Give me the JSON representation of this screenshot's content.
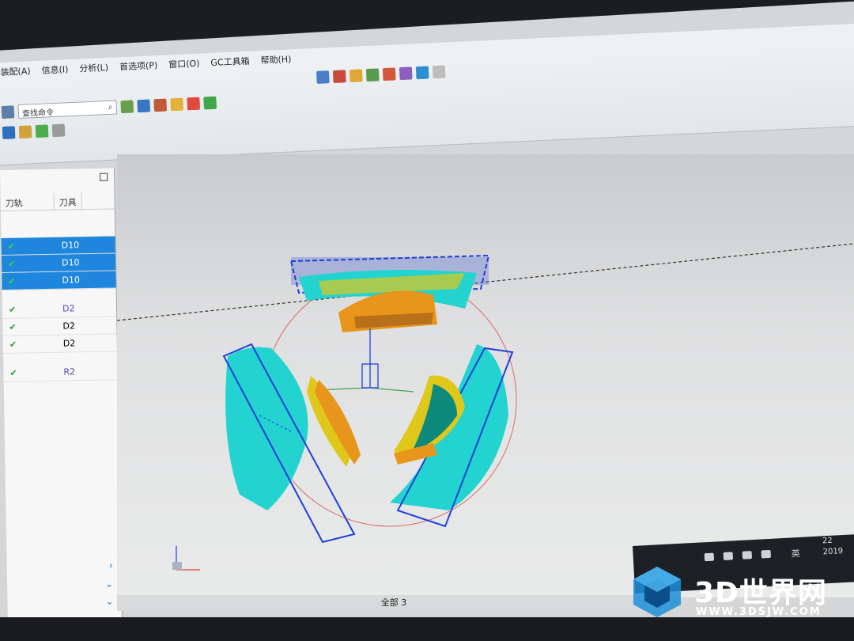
{
  "menu": {
    "items": [
      "装配(A)",
      "信息(I)",
      "分析(L)",
      "首选项(P)",
      "窗口(O)",
      "GC工具箱",
      "帮助(H)"
    ]
  },
  "toolbar": {
    "search_placeholder": "查找命令"
  },
  "navigator": {
    "columns": [
      "刀轨",
      "刀具"
    ],
    "rows": [
      {
        "tool": "D10",
        "selected": true
      },
      {
        "tool": "D10",
        "selected": true
      },
      {
        "tool": "D10",
        "selected": true
      },
      {
        "tool": "D2",
        "selected": false
      },
      {
        "tool": "D2",
        "selected": false
      },
      {
        "tool": "D2",
        "selected": false
      },
      {
        "tool": "R2",
        "selected": false
      }
    ]
  },
  "status_bar": {
    "text": "全部 3"
  },
  "taskbar": {
    "ime": "英",
    "clock_line1": "22",
    "clock_line2": "2019"
  },
  "watermark": {
    "title": "3D世界网",
    "url": "WWW.3DSJW.COM"
  },
  "colors": {
    "part_orange": "#e8951c",
    "part_yellow": "#e0c81a",
    "toolpath_cyan": "#22d3d0",
    "toolpath_blue": "#1e3fd8",
    "selection_blue": "#1f86dd"
  }
}
